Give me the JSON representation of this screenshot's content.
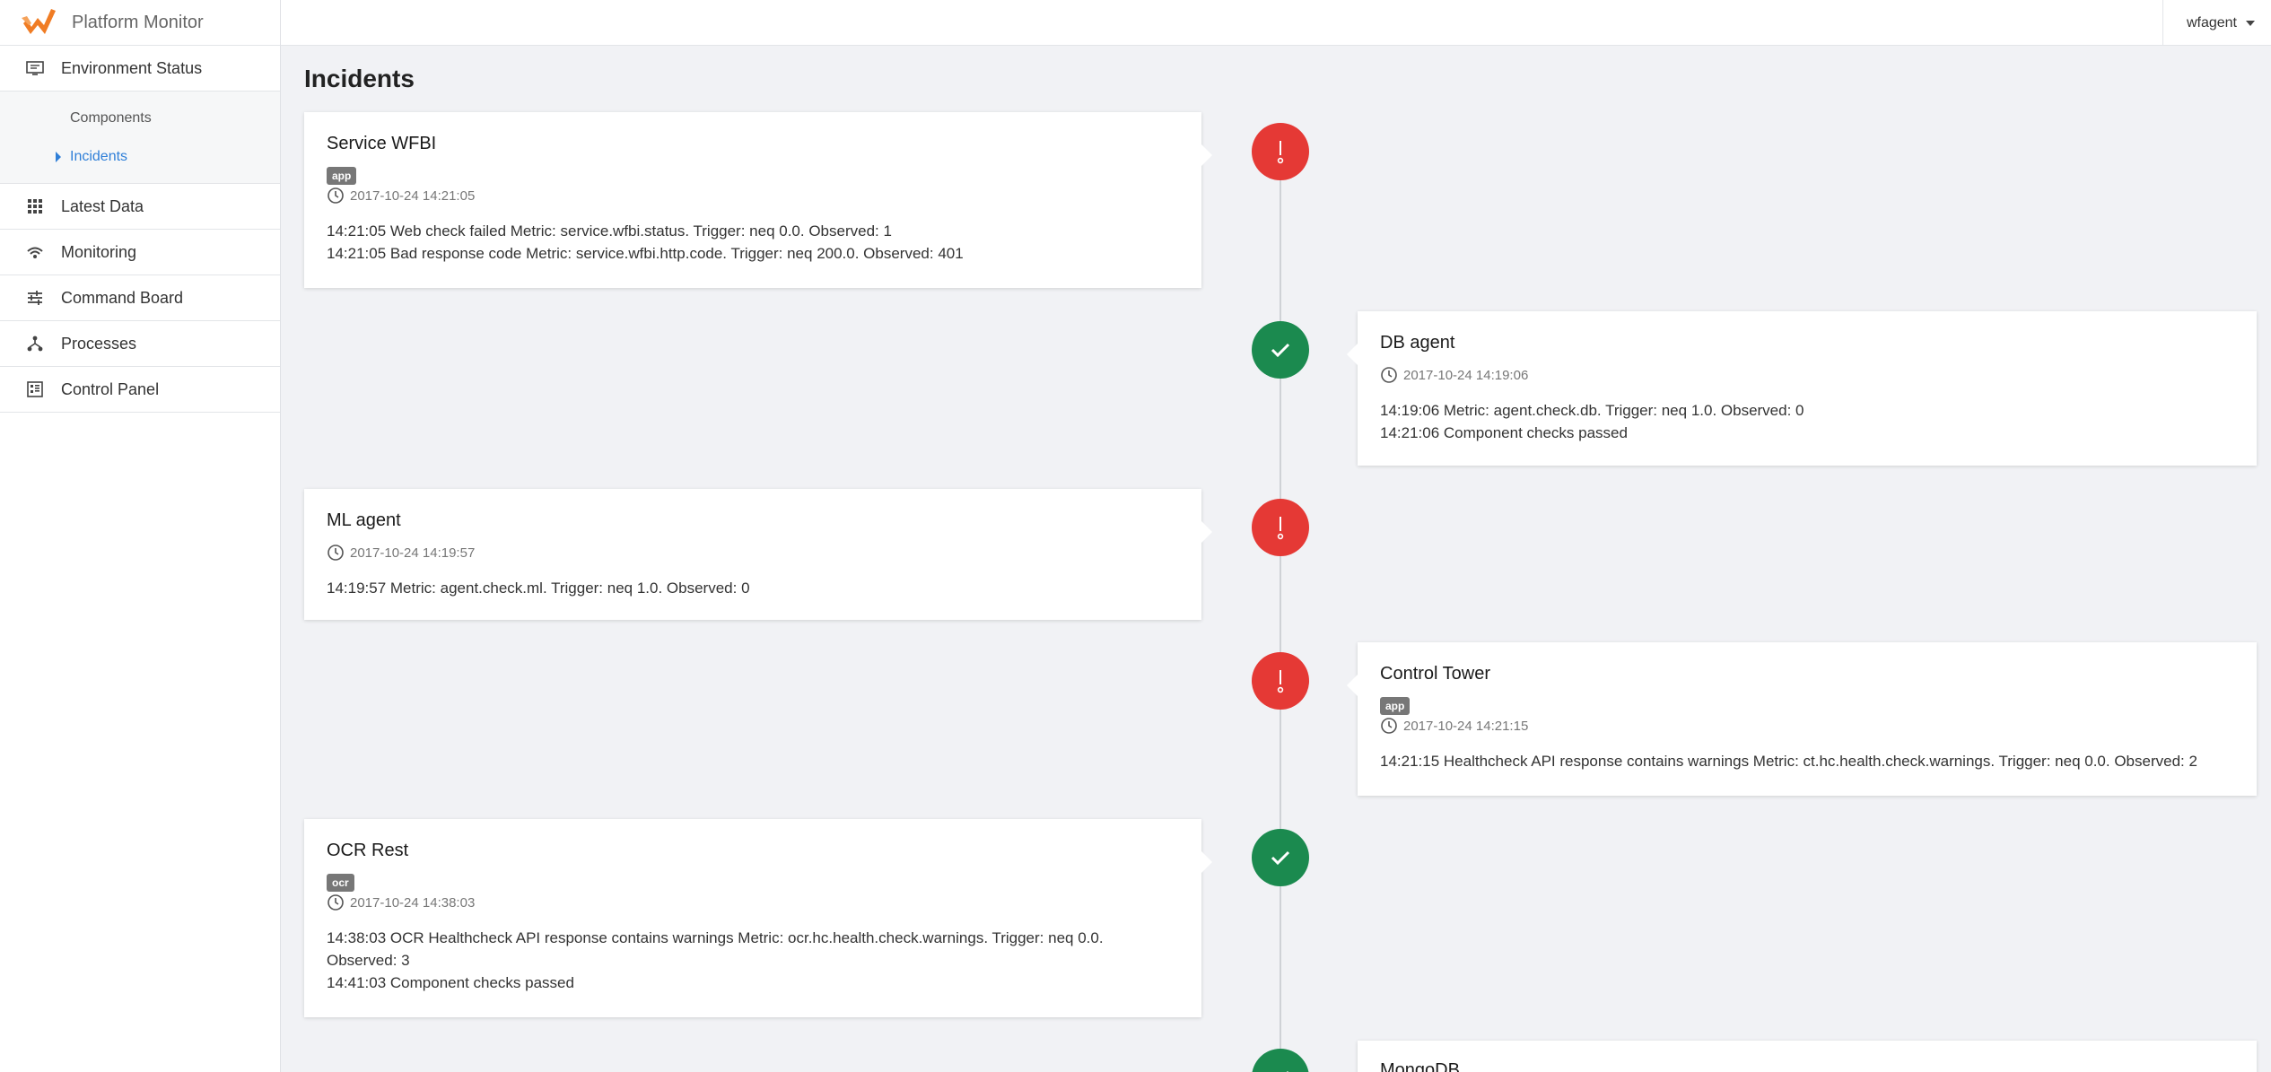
{
  "app": {
    "name": "Platform Monitor"
  },
  "user": {
    "name": "wfagent"
  },
  "sidebar": {
    "environment_status": "Environment Status",
    "sub_items": [
      "Components",
      "Incidents"
    ],
    "items": [
      "Latest Data",
      "Monitoring",
      "Command Board",
      "Processes",
      "Control Panel"
    ]
  },
  "page": {
    "title": "Incidents"
  },
  "incidents": [
    {
      "title": "Service WFBI",
      "tag": "app",
      "timestamp": "2017-10-24 14:21:05",
      "status": "error",
      "lines": [
        "14:21:05 Web check failed Metric: service.wfbi.status. Trigger: neq 0.0. Observed: 1",
        "14:21:05 Bad response code Metric: service.wfbi.http.code. Trigger: neq 200.0. Observed: 401"
      ]
    },
    {
      "title": "DB agent",
      "tag": "",
      "timestamp": "2017-10-24 14:19:06",
      "status": "ok",
      "lines": [
        "14:19:06 Metric: agent.check.db. Trigger: neq 1.0. Observed: 0",
        "14:21:06 Component checks passed"
      ]
    },
    {
      "title": "ML agent",
      "tag": "",
      "timestamp": "2017-10-24 14:19:57",
      "status": "error",
      "lines": [
        "14:19:57 Metric: agent.check.ml. Trigger: neq 1.0. Observed: 0"
      ]
    },
    {
      "title": "Control Tower",
      "tag": "app",
      "timestamp": "2017-10-24 14:21:15",
      "status": "error",
      "lines": [
        "14:21:15 Healthcheck API response contains warnings Metric: ct.hc.health.check.warnings. Trigger: neq 0.0. Observed: 2"
      ]
    },
    {
      "title": "OCR Rest",
      "tag": "ocr",
      "timestamp": "2017-10-24 14:38:03",
      "status": "ok",
      "lines": [
        "14:38:03 OCR Healthcheck API response contains warnings Metric: ocr.hc.health.check.warnings. Trigger: neq 0.0.",
        "Observed: 3",
        "14:41:03 Component checks passed"
      ]
    },
    {
      "title": "MongoDB",
      "tag": "",
      "timestamp": "",
      "status": "ok",
      "lines": []
    }
  ],
  "colors": {
    "error": "#e53935",
    "ok": "#1b8a4f",
    "link": "#2f7fd8",
    "logo": "#f07c24"
  }
}
